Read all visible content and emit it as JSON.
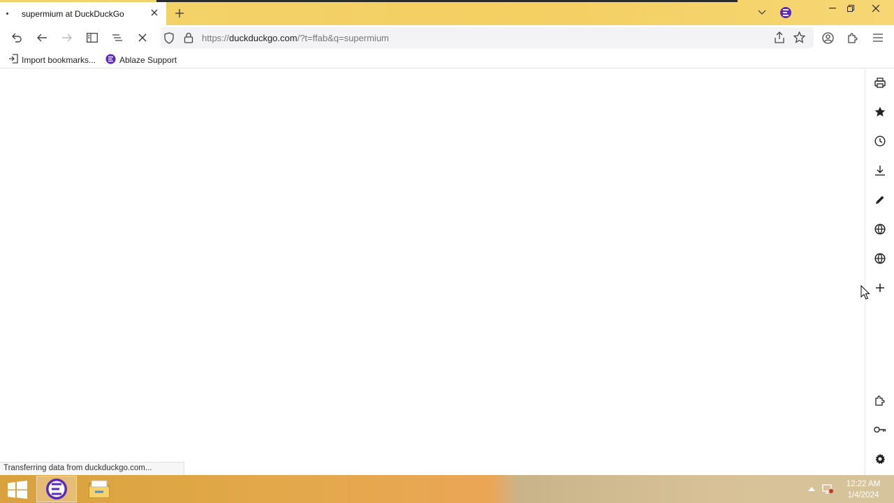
{
  "browser": {
    "tab": {
      "title": "supermium at DuckDuckGo"
    },
    "url": {
      "host": "duckduckgo.com",
      "prefix": "https://",
      "path": "/?t=ffab&q=supermium"
    },
    "bookmarks": [
      {
        "label": "Import bookmarks...",
        "icon": "import-icon"
      },
      {
        "label": "Ablaze Support",
        "icon": "ablaze-logo-icon"
      }
    ],
    "status": "Transferring data from duckduckgo.com...",
    "sidebar_icons": [
      "printer-icon",
      "star-icon",
      "history-clock-icon",
      "download-icon",
      "pen-icon",
      "globe-icon",
      "globe-icon",
      "plus-icon",
      "extension-puzzle-icon",
      "key-icon",
      "gear-icon"
    ]
  },
  "taskbar": {
    "time": "12:22 AM",
    "date": "1/4/2024"
  },
  "colors": {
    "titlebar": "#f2d36b",
    "accent_logo": "#5a2ab8"
  }
}
